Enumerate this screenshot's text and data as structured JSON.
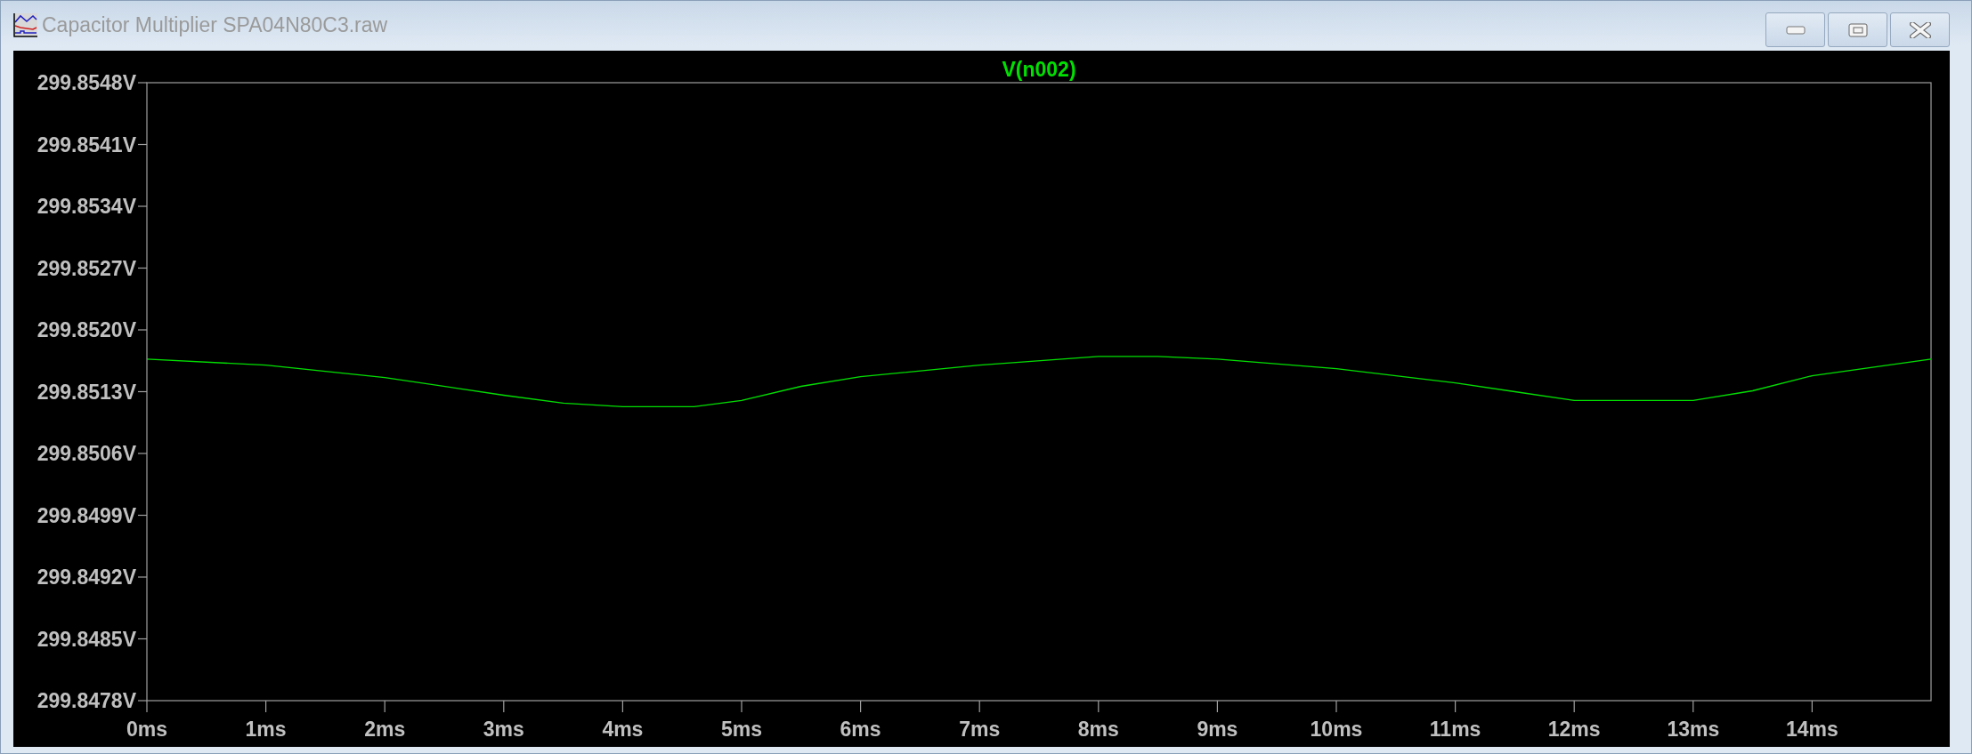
{
  "window": {
    "title": "Capacitor Multiplier SPA04N80C3.raw"
  },
  "plot": {
    "chart_data": {
      "type": "line",
      "x": [
        0,
        1,
        2,
        3,
        3.5,
        4,
        4.6,
        5,
        5.5,
        6,
        7,
        8,
        8.5,
        9,
        10,
        11,
        11.5,
        12,
        13,
        13.5,
        14,
        15
      ],
      "series": [
        {
          "name": "V(n002)",
          "color": "#00e000",
          "values": [
            299.85167,
            299.8516,
            299.85146,
            299.85126,
            299.85117,
            299.85113,
            299.85113,
            299.8512,
            299.85136,
            299.85147,
            299.8516,
            299.8517,
            299.8517,
            299.85167,
            299.85156,
            299.8514,
            299.8513,
            299.8512,
            299.8512,
            299.85131,
            299.85148,
            299.85167
          ]
        }
      ],
      "xlim": [
        0,
        15
      ],
      "ylim": [
        299.8478,
        299.8548
      ],
      "xticks": [
        {
          "value": 0,
          "label": "0ms"
        },
        {
          "value": 1,
          "label": "1ms"
        },
        {
          "value": 2,
          "label": "2ms"
        },
        {
          "value": 3,
          "label": "3ms"
        },
        {
          "value": 4,
          "label": "4ms"
        },
        {
          "value": 5,
          "label": "5ms"
        },
        {
          "value": 6,
          "label": "6ms"
        },
        {
          "value": 7,
          "label": "7ms"
        },
        {
          "value": 8,
          "label": "8ms"
        },
        {
          "value": 9,
          "label": "9ms"
        },
        {
          "value": 10,
          "label": "10ms"
        },
        {
          "value": 11,
          "label": "11ms"
        },
        {
          "value": 12,
          "label": "12ms"
        },
        {
          "value": 13,
          "label": "13ms"
        },
        {
          "value": 14,
          "label": "14ms"
        }
      ],
      "yticks": [
        {
          "value": 299.8548,
          "label": "299.8548V"
        },
        {
          "value": 299.8541,
          "label": "299.8541V"
        },
        {
          "value": 299.8534,
          "label": "299.8534V"
        },
        {
          "value": 299.8527,
          "label": "299.8527V"
        },
        {
          "value": 299.852,
          "label": "299.8520V"
        },
        {
          "value": 299.8513,
          "label": "299.8513V"
        },
        {
          "value": 299.8506,
          "label": "299.8506V"
        },
        {
          "value": 299.8499,
          "label": "299.8499V"
        },
        {
          "value": 299.8492,
          "label": "299.8492V"
        },
        {
          "value": 299.8485,
          "label": "299.8485V"
        },
        {
          "value": 299.8478,
          "label": "299.8478V"
        }
      ]
    }
  }
}
